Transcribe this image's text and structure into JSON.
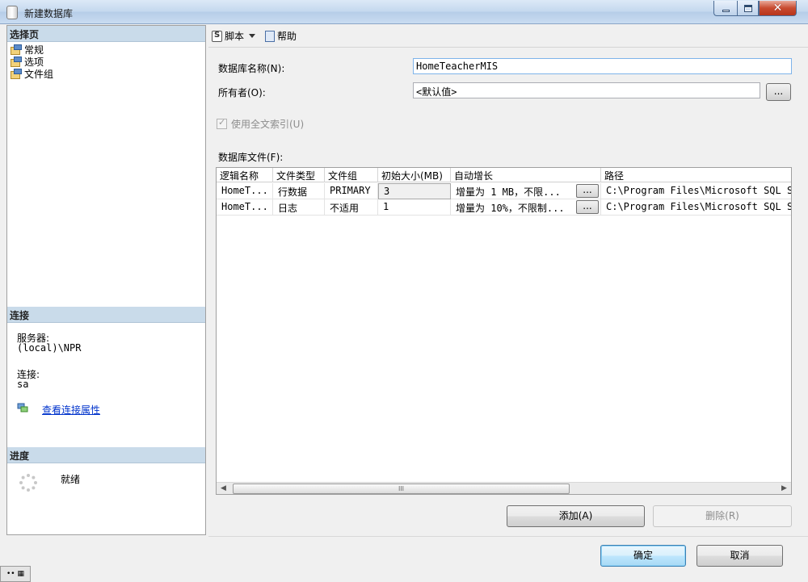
{
  "window": {
    "title": "新建数据库"
  },
  "left": {
    "select_page_header": "选择页",
    "pages": [
      "常规",
      "选项",
      "文件组"
    ],
    "connection_header": "连接",
    "server_label": "服务器:",
    "server_value": "(local)\\NPR",
    "connection_label": "连接:",
    "connection_value": "sa",
    "view_props_link": "查看连接属性",
    "progress_header": "进度",
    "progress_status": "就绪"
  },
  "toolbar": {
    "script_label": "脚本",
    "help_label": "帮助"
  },
  "form": {
    "db_name_label": "数据库名称(N):",
    "db_name_value": "HomeTeacherMIS",
    "owner_label": "所有者(O):",
    "owner_value": "<默认值>",
    "ellipsis": "...",
    "fulltext_label": "使用全文索引(U)",
    "files_label": "数据库文件(F):"
  },
  "grid": {
    "columns": [
      "逻辑名称",
      "文件类型",
      "文件组",
      "初始大小(MB)",
      "自动增长",
      "路径"
    ],
    "rows": [
      [
        "HomeT...",
        "行数据",
        "PRIMARY",
        "3",
        "增量为 1 MB，不限...",
        "C:\\Program Files\\Microsoft SQL Server"
      ],
      [
        "HomeT...",
        "日志",
        "不适用",
        "1",
        "增量为 10%，不限制...",
        "C:\\Program Files\\Microsoft SQL Server"
      ]
    ],
    "scroll_thumb": "III"
  },
  "buttons": {
    "add": "添加(A)",
    "remove": "删除(R)",
    "ok": "确定",
    "cancel": "取消"
  }
}
